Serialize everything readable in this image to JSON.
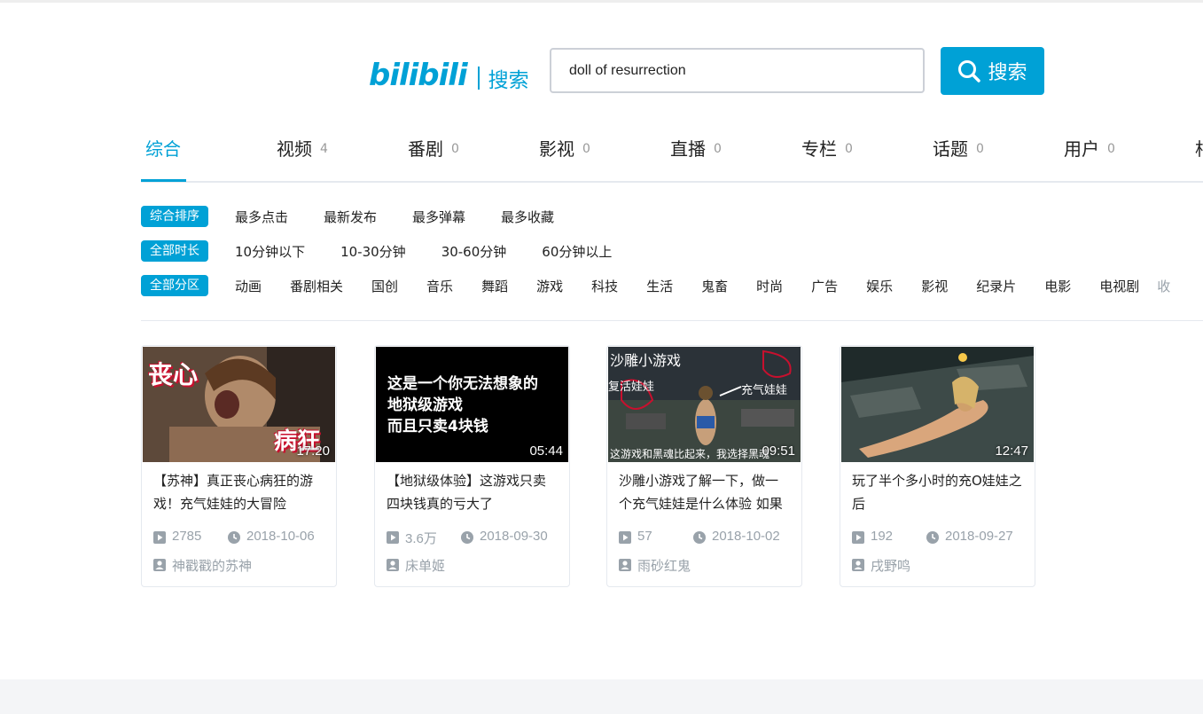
{
  "logo": {
    "text": "bilibili",
    "subtitle": "搜索"
  },
  "search": {
    "query": "doll of resurrection",
    "button_label": "搜索"
  },
  "tabs": [
    {
      "label": "综合",
      "count": ""
    },
    {
      "label": "视频",
      "count": "4"
    },
    {
      "label": "番剧",
      "count": "0"
    },
    {
      "label": "影视",
      "count": "0"
    },
    {
      "label": "直播",
      "count": "0"
    },
    {
      "label": "专栏",
      "count": "0"
    },
    {
      "label": "话题",
      "count": "0"
    },
    {
      "label": "用户",
      "count": "0"
    },
    {
      "label": "相",
      "count": ""
    }
  ],
  "filters": {
    "sort": {
      "chip": "综合排序",
      "options": [
        "最多点击",
        "最新发布",
        "最多弹幕",
        "最多收藏"
      ]
    },
    "duration": {
      "chip": "全部时长",
      "options": [
        "10分钟以下",
        "10-30分钟",
        "30-60分钟",
        "60分钟以上"
      ]
    },
    "zone": {
      "chip": "全部分区",
      "options": [
        "动画",
        "番剧相关",
        "国创",
        "音乐",
        "舞蹈",
        "游戏",
        "科技",
        "生活",
        "鬼畜",
        "时尚",
        "广告",
        "娱乐",
        "影视",
        "纪录片",
        "电影",
        "电视剧"
      ],
      "collapse": "收"
    }
  },
  "results": [
    {
      "title": "【苏神】真正丧心病狂的游戏！充气娃娃的大冒险",
      "duration": "17:20",
      "plays": "2785",
      "date": "2018-10-06",
      "uploader": "神戳戳的苏神",
      "thumb": {
        "text1": "丧心",
        "text2": "病狂"
      }
    },
    {
      "title": "【地狱级体验】这游戏只卖四块钱真的亏大了",
      "duration": "05:44",
      "plays": "3.6万",
      "date": "2018-09-30",
      "uploader": "床单姬",
      "thumb": {
        "line1": "这是一个你无法想象的",
        "line2": "地狱级游戏",
        "line3": "而且只卖4块钱"
      }
    },
    {
      "title": "沙雕小游戏了解一下，做一个充气娃娃是什么体验 如果",
      "duration": "09:51",
      "plays": "57",
      "date": "2018-10-02",
      "uploader": "雨砂红鬼",
      "thumb": {
        "top": "沙雕小游戏",
        "left": "复活娃娃",
        "right": "充气娃娃",
        "bottom": "这游戏和黑魂比起来，我选择黑魂"
      }
    },
    {
      "title": "玩了半个多小时的充O娃娃之后",
      "duration": "12:47",
      "plays": "192",
      "date": "2018-09-27",
      "uploader": "戌野鸣",
      "thumb": {}
    }
  ],
  "colors": {
    "accent": "#00a1d6",
    "muted": "#99a2aa",
    "border": "#e5e9ef"
  }
}
